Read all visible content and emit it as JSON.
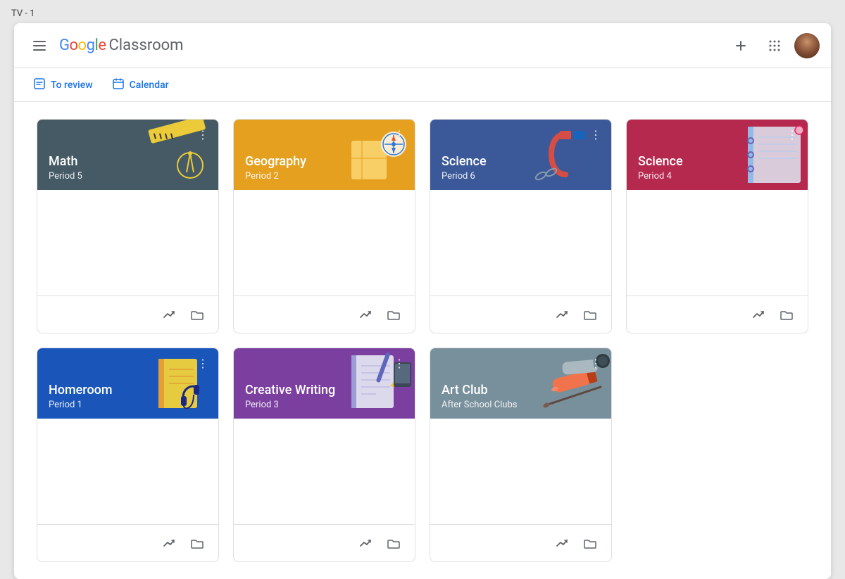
{
  "window": {
    "title": "TV - 1"
  },
  "header": {
    "logo_google": "Google",
    "logo_classroom": "Classroom",
    "add_label": "+",
    "apps_label": "⠿"
  },
  "nav": {
    "to_review_label": "To review",
    "calendar_label": "Calendar"
  },
  "cards_row1": [
    {
      "id": "math",
      "title": "Math",
      "subtitle": "Period 5",
      "color": "math",
      "bg_color": "#455a64"
    },
    {
      "id": "geography",
      "title": "Geography",
      "subtitle": "Period 2",
      "color": "geography",
      "bg_color": "#e5a020"
    },
    {
      "id": "science6",
      "title": "Science",
      "subtitle": "Period 6",
      "color": "science-6",
      "bg_color": "#3b5998"
    },
    {
      "id": "science4",
      "title": "Science",
      "subtitle": "Period 4",
      "color": "science-4",
      "bg_color": "#b5294e"
    }
  ],
  "cards_row2": [
    {
      "id": "homeroom",
      "title": "Homeroom",
      "subtitle": "Period 1",
      "color": "homeroom",
      "bg_color": "#1a56ba"
    },
    {
      "id": "creative",
      "title": "Creative Writing",
      "subtitle": "Period 3",
      "color": "creative",
      "bg_color": "#7b3fa0"
    },
    {
      "id": "artclub",
      "title": "Art Club",
      "subtitle": "After School Clubs",
      "color": "artclub",
      "bg_color": "#78909c"
    }
  ],
  "footer": {
    "trend_icon": "↗",
    "folder_icon": "🗂"
  }
}
